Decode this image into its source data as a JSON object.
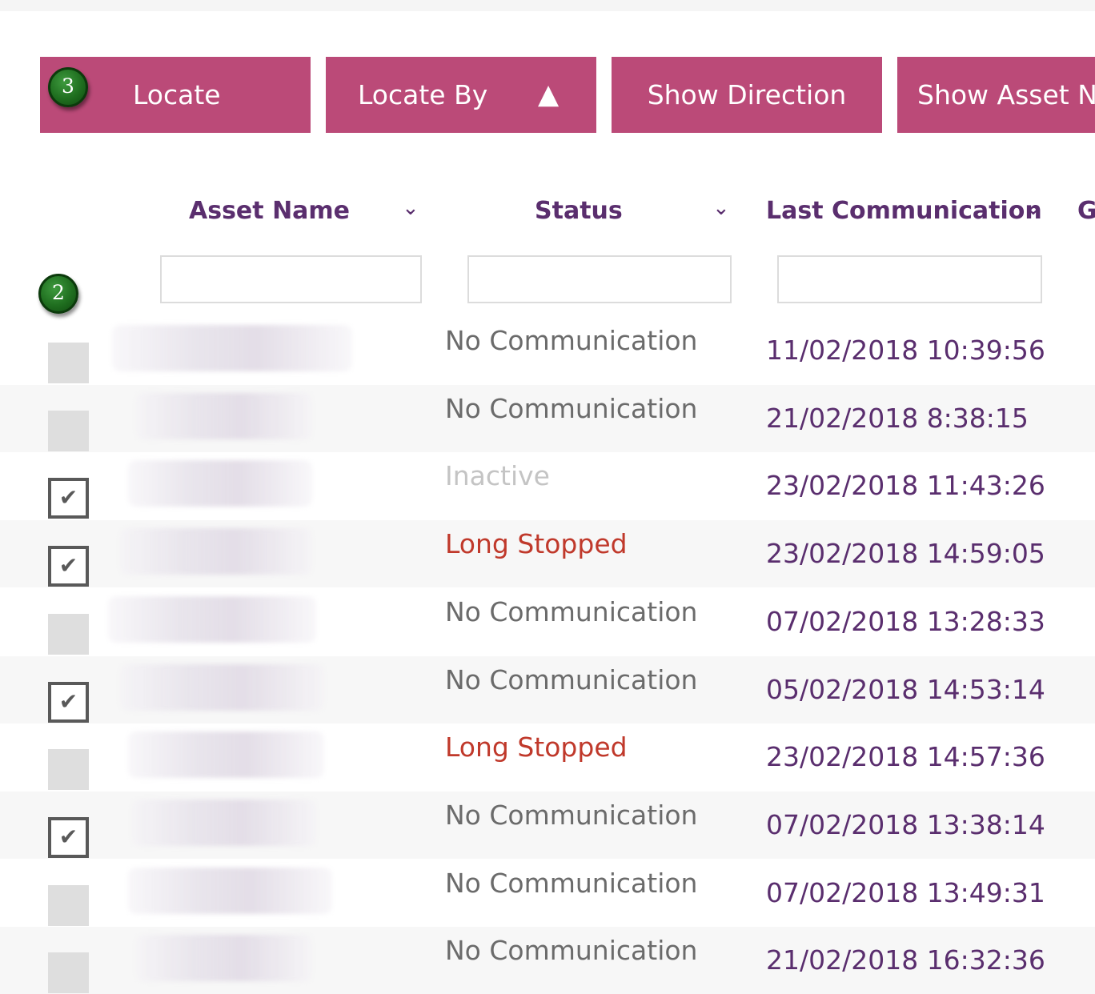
{
  "toolbar": {
    "locate_label": "Locate",
    "locate_by_label": "Locate By",
    "locate_by_arrow": "▲",
    "show_direction_label": "Show Direction",
    "show_asset_label": "Show Asset N"
  },
  "markers": {
    "step3": "3",
    "step2": "2"
  },
  "table": {
    "columns": [
      {
        "label": "Asset Name",
        "sort_icon": "chevron-down-icon"
      },
      {
        "label": "Status",
        "sort_icon": "chevron-down-icon"
      },
      {
        "label": "Last Communication",
        "sort_icon": "chevron-down-icon"
      },
      {
        "label": "G"
      }
    ],
    "chevron": "⌄",
    "filters": {
      "asset_name": "",
      "status": "",
      "last_communication": ""
    },
    "rows": [
      {
        "checked": false,
        "status": "No Communication",
        "status_type": "nocomm",
        "last_communication": "11/02/2018 10:39:56"
      },
      {
        "checked": false,
        "status": "No Communication",
        "status_type": "nocomm",
        "last_communication": "21/02/2018 8:38:15"
      },
      {
        "checked": true,
        "status": "Inactive",
        "status_type": "inactive",
        "last_communication": "23/02/2018 11:43:26"
      },
      {
        "checked": true,
        "status": "Long Stopped",
        "status_type": "stopped",
        "last_communication": "23/02/2018 14:59:05"
      },
      {
        "checked": false,
        "status": "No Communication",
        "status_type": "nocomm",
        "last_communication": "07/02/2018 13:28:33"
      },
      {
        "checked": true,
        "status": "No Communication",
        "status_type": "nocomm",
        "last_communication": "05/02/2018 14:53:14"
      },
      {
        "checked": false,
        "status": "Long Stopped",
        "status_type": "stopped",
        "last_communication": "23/02/2018 14:57:36"
      },
      {
        "checked": true,
        "status": "No Communication",
        "status_type": "nocomm",
        "last_communication": "07/02/2018 13:38:14"
      },
      {
        "checked": false,
        "status": "No Communication",
        "status_type": "nocomm",
        "last_communication": "07/02/2018 13:49:31"
      },
      {
        "checked": false,
        "status": "No Communication",
        "status_type": "nocomm",
        "last_communication": "21/02/2018 16:32:36"
      }
    ],
    "checkmark": "✔"
  },
  "colors": {
    "button_bg": "#bb4a78",
    "header_text": "#5a2e6e",
    "status_default": "#6b6b6b",
    "status_inactive": "#c4c4c4",
    "status_stopped": "#c0392b",
    "marker_green": "#1f6e1f"
  }
}
